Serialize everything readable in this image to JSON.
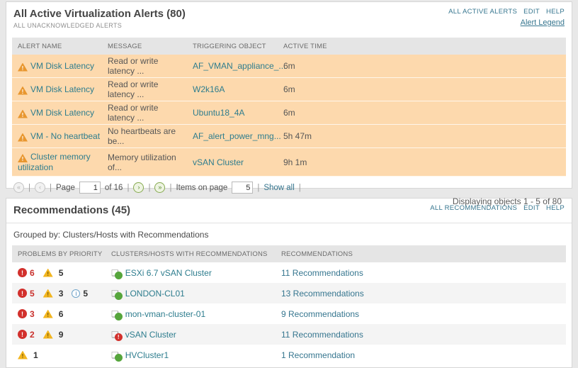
{
  "colors": {
    "accent_link": "#36768f",
    "alert_row_bg": "#fdd9ad",
    "critical": "#d2302c",
    "warning_alert": "#e8962e",
    "warning_rec": "#f2b51f",
    "status_up": "#56a53c",
    "header_bg": "#e5e5e5"
  },
  "alerts_panel": {
    "title": "All Active Virtualization Alerts (80)",
    "subtitle": "ALL UNACKNOWLEDGED ALERTS",
    "links": {
      "all": "ALL ACTIVE ALERTS",
      "edit": "EDIT",
      "help": "HELP"
    },
    "legend_link": "Alert Legend",
    "columns": {
      "name": "ALERT NAME",
      "message": "MESSAGE",
      "object": "TRIGGERING OBJECT",
      "time": "ACTIVE TIME"
    },
    "warning_glyph": "!",
    "rows": [
      {
        "name": "VM Disk Latency",
        "message": "Read or write latency ...",
        "object": "AF_VMAN_appliance_...",
        "time": "6m"
      },
      {
        "name": "VM Disk Latency",
        "message": "Read or write latency ...",
        "object": "W2k16A",
        "time": "6m"
      },
      {
        "name": "VM Disk Latency",
        "message": "Read or write latency ...",
        "object": "Ubuntu18_4A",
        "time": "6m"
      },
      {
        "name": "VM - No heartbeat",
        "message": "No heartbeats are be...",
        "object": "AF_alert_power_mng...",
        "time": "5h 47m"
      },
      {
        "name": "Cluster memory utilization",
        "message": "Memory utilization of...",
        "object": "vSAN Cluster",
        "time": "9h 1m"
      }
    ],
    "pagination": {
      "sep": "|",
      "first_icon": "«",
      "prev_icon": "‹",
      "next_icon": "›",
      "last_icon": "»",
      "page_label": "Page",
      "page_value": "1",
      "of_label": "of 16",
      "items_label": "Items on page",
      "items_value": "5",
      "show_all": "Show all",
      "summary": "Displaying objects 1 - 5 of 80"
    }
  },
  "recommendations_panel": {
    "title": "Recommendations (45)",
    "links": {
      "all": "ALL RECOMMENDATIONS",
      "edit": "EDIT",
      "help": "HELP"
    },
    "grouped_by": "Grouped by: Clusters/Hosts with Recommendations",
    "columns": {
      "priority": "PROBLEMS BY PRIORITY",
      "clusters": "CLUSTERS/HOSTS WITH RECOMMENDATIONS",
      "recommendations": "RECOMMENDATIONS"
    },
    "glyphs": {
      "critical": "!",
      "warning": "!",
      "info": "i",
      "status_critical": "!",
      "cluster": "❏"
    },
    "rows": [
      {
        "critical": "6",
        "warning": "5",
        "info": "",
        "cluster": "ESXi 6.7 vSAN Cluster",
        "status": "up",
        "recommendation": "11 Recommendations"
      },
      {
        "critical": "5",
        "warning": "3",
        "info": "5",
        "cluster": "LONDON-CL01",
        "status": "up",
        "recommendation": "13 Recommendations"
      },
      {
        "critical": "3",
        "warning": "6",
        "info": "",
        "cluster": "mon-vman-cluster-01",
        "status": "up",
        "recommendation": "9 Recommendations"
      },
      {
        "critical": "2",
        "warning": "9",
        "info": "",
        "cluster": "vSAN Cluster",
        "status": "critical",
        "recommendation": "11 Recommendations"
      },
      {
        "critical": "",
        "warning": "1",
        "info": "",
        "cluster": "HVCluster1",
        "status": "up",
        "recommendation": "1 Recommendation"
      }
    ]
  }
}
